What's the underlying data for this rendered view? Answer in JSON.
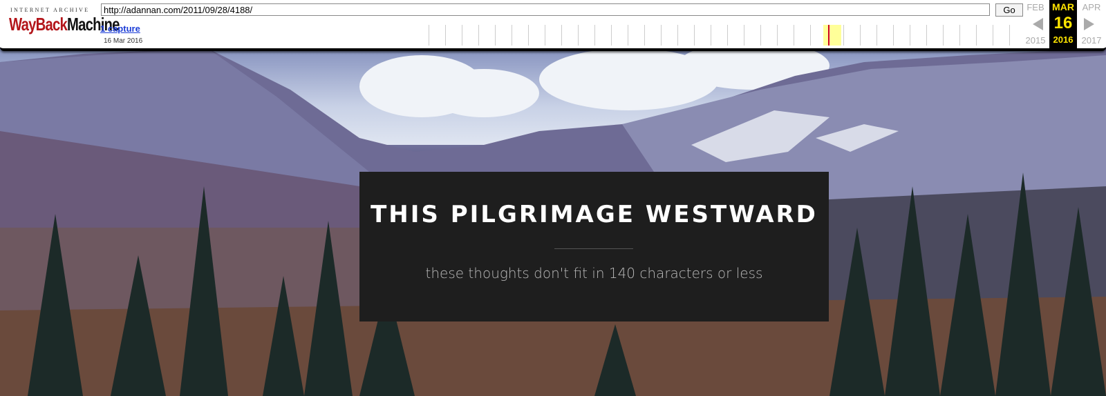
{
  "wayback": {
    "logo_top": "INTERNET ARCHIVE",
    "logo_wayback": "WayBack",
    "logo_machine": "Machine",
    "url_value": "http://adannan.com/2011/09/28/4188/",
    "go_label": "Go",
    "captures_label": "1 capture",
    "capture_date": "16 Mar 2016",
    "prev_month": "FEB",
    "current_month": "MAR",
    "next_month": "APR",
    "current_day": "16",
    "prev_year": "2015",
    "current_year": "2016",
    "next_year": "2017",
    "accent_color": "#ffe500"
  },
  "hero": {
    "title": "THIS PILGRIMAGE WESTWARD",
    "tagline": "these thoughts don't fit in 140 characters or less"
  }
}
